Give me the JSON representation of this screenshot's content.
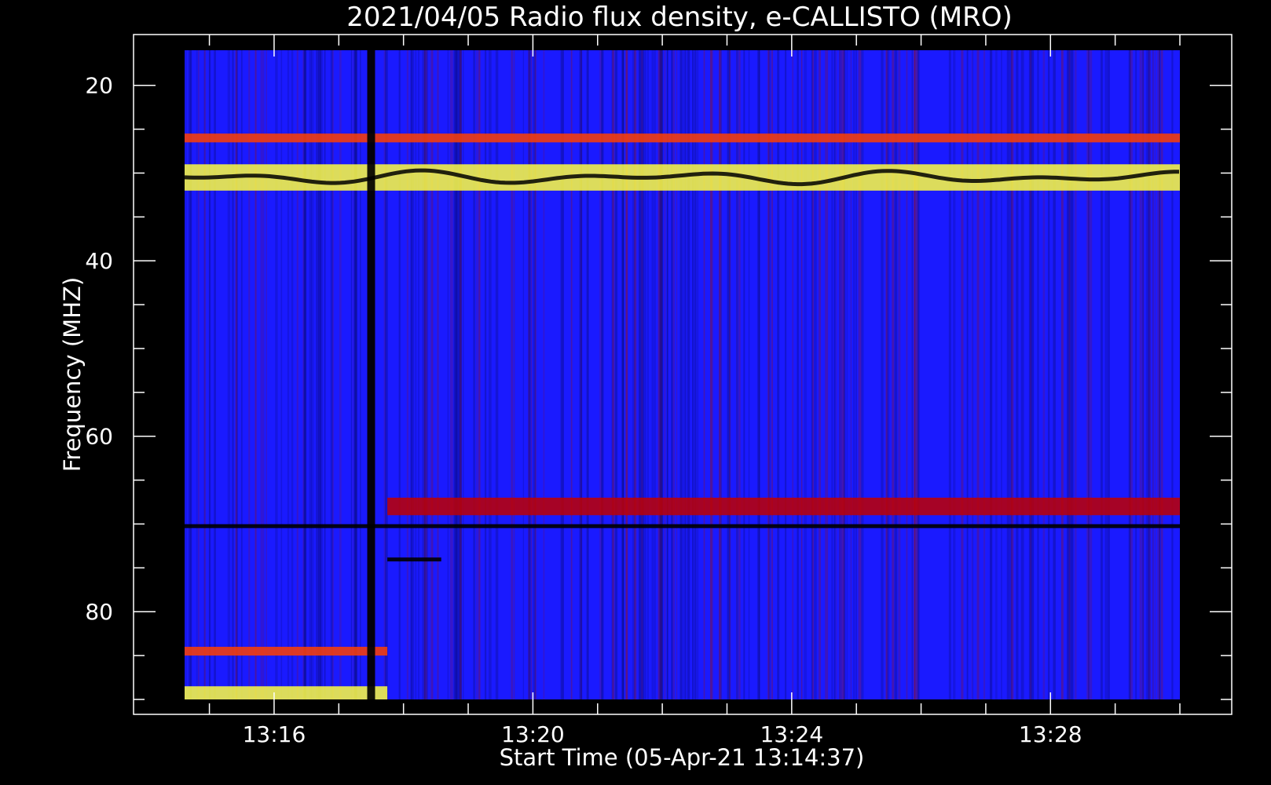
{
  "chart_data": {
    "type": "heatmap",
    "title": "2021/04/05  Radio flux density, e-CALLISTO (MRO)",
    "xlabel": "Start Time (05-Apr-21 13:14:37)",
    "ylabel": "Frequency (MHZ)",
    "x_range": [
      "13:14:37",
      "13:30:00"
    ],
    "y_range": [
      16,
      90
    ],
    "y_axis_inverted": true,
    "x_ticks": [
      "13:16",
      "13:20",
      "13:24",
      "13:28"
    ],
    "y_ticks": [
      20,
      40,
      60,
      80
    ],
    "colormap": [
      "#000000",
      "#1a1aff",
      "#c00000",
      "#ff4000",
      "#ffff40"
    ],
    "background_color": "#000000",
    "features": [
      {
        "kind": "band",
        "freq_range": [
          25.5,
          26.5
        ],
        "time_range": [
          "13:14:37",
          "13:30:00"
        ],
        "intensity": 0.75
      },
      {
        "kind": "band",
        "freq_range": [
          29,
          32
        ],
        "time_range": [
          "13:14:37",
          "13:30:00"
        ],
        "intensity": 0.95
      },
      {
        "kind": "band",
        "freq_range": [
          67,
          69
        ],
        "time_range": [
          "13:17:45",
          "13:30:00"
        ],
        "intensity": 0.65
      },
      {
        "kind": "band",
        "freq_range": [
          88.5,
          90
        ],
        "time_range": [
          "13:14:37",
          "13:17:45"
        ],
        "intensity": 1.0
      },
      {
        "kind": "band",
        "freq_range": [
          84,
          85
        ],
        "time_range": [
          "13:14:37",
          "13:17:45"
        ],
        "intensity": 0.9
      },
      {
        "kind": "dark_line",
        "freq": 70.2,
        "time_range": [
          "13:14:37",
          "13:30:00"
        ]
      },
      {
        "kind": "dark_line",
        "freq": 74,
        "time_range": [
          "13:17:45",
          "13:18:35"
        ]
      },
      {
        "kind": "dark_column",
        "time": "13:17:30",
        "freq_range": [
          16,
          90
        ]
      }
    ]
  }
}
